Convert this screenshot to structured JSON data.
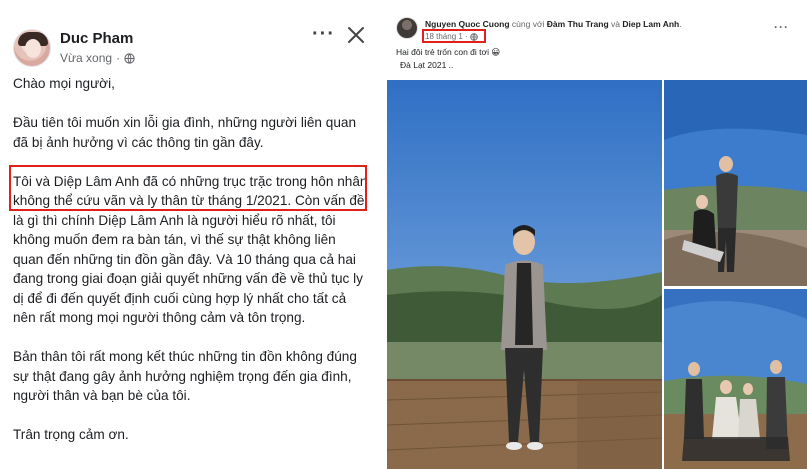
{
  "left_post": {
    "author": "Duc Pham",
    "time": "Vừa xong",
    "more_icon": "more-horizontal-icon",
    "close_icon": "close-icon",
    "privacy_icon": "globe-icon",
    "paragraphs": [
      "Chào mọi người,",
      "Đầu tiên tôi muốn xin lỗi gia đình, những người liên quan đã bị ảnh hưởng vì các thông tin gần đây.",
      "Tôi và Diệp Lâm Anh đã có những trục trặc trong hôn nhân không thể cứu vãn và ly thân từ tháng 1/2021. Còn vấn đề là gì thì chính Diệp Lâm Anh là người hiểu rõ nhất, tôi không muốn đem ra bàn tán, vì thế sự thật không liên quan đến những tin đồn gần đây. Và 10 tháng qua cả hai đang trong giai đoạn giải quyết những vấn đề về thủ tục ly dị để đi đến quyết định cuối cùng hợp lý nhất cho tất cả nên rất mong mọi người thông cảm và tôn trọng.",
      "Bản thân tôi rất mong kết thúc những tin đồn không đúng sự thật đang gây ảnh hưởng nghiệm trọng đến gia đình, người thân và bạn bè của tôi.",
      "Trân trọng cảm ơn."
    ],
    "highlight_color": "#e0211a"
  },
  "right_post": {
    "author": "Nguyen Quoc Cuong",
    "with_text": "cùng với",
    "tagged_1": "Đàm Thu Trang",
    "and_text": "và",
    "tagged_2": "Diep Lam Anh",
    "time": "18 tháng 1 ·",
    "privacy_icon": "globe-icon",
    "more_icon": "more-horizontal-icon",
    "caption_line1": "Hai đôi trẻ trốn con đi tơi 😀",
    "caption_line2": "Đà Lạt 2021 ..",
    "photos": [
      "man-on-deck-photo",
      "couple-on-rock-photo",
      "group-of-four-photo"
    ]
  }
}
